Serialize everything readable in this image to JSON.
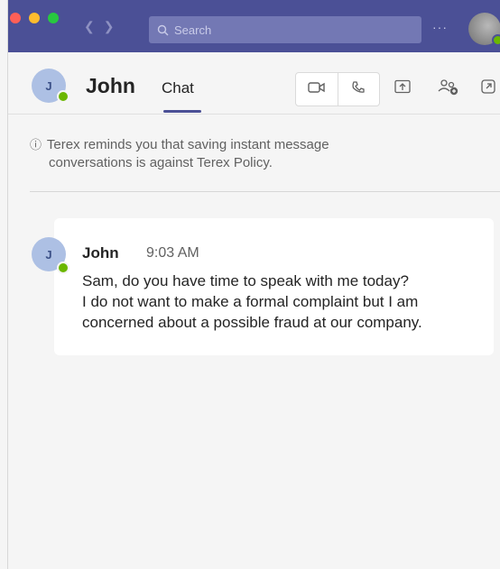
{
  "titlebar": {
    "search_placeholder": "Search",
    "more_label": "···"
  },
  "header": {
    "contact_name": "John",
    "contact_initial": "J",
    "tab_chat": "Chat"
  },
  "notice": {
    "icon": "ⓘ",
    "line1": "Terex reminds you that saving instant message",
    "line2": "conversations is against Terex Policy."
  },
  "message": {
    "sender": "John",
    "sender_initial": "J",
    "time": "9:03 AM",
    "lines": [
      "Sam, do you have time to speak with me today?",
      "I do not want to make a formal complaint but I am",
      "concerned about a possible fraud at our company."
    ]
  },
  "colors": {
    "titlebar": "#4b5096",
    "accent": "#4b5096",
    "presence": "#6bb700"
  },
  "icons": [
    "search-icon",
    "video-call-icon",
    "audio-call-icon",
    "share-screen-icon",
    "add-people-icon",
    "pop-out-icon",
    "info-icon"
  ]
}
